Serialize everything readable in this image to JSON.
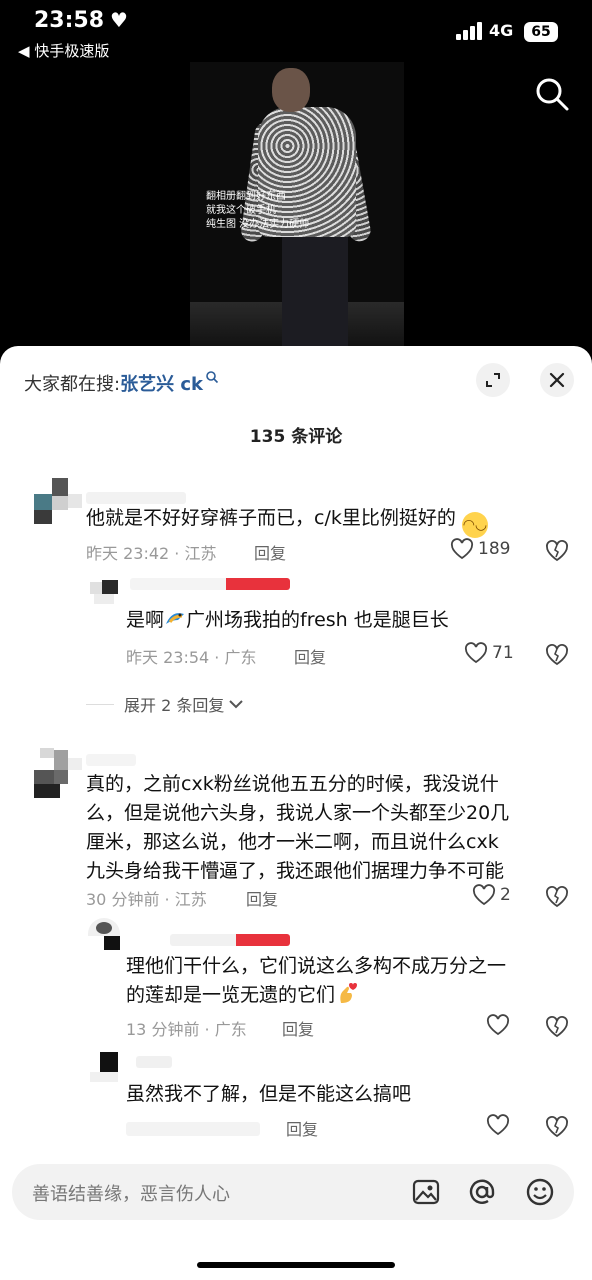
{
  "status": {
    "time": "23:58",
    "back_app": "快手极速版",
    "network": "4G",
    "battery": "65"
  },
  "video": {
    "caption": "翻相册翻到好东西\n就我这个破手机\n纯生图 没办法实力硬帅"
  },
  "sheet": {
    "search_prefix": "大家都在搜:",
    "search_keyword": "张艺兴 ck",
    "comment_count": "135 条评论"
  },
  "comments": [
    {
      "text": "他就是不好好穿裤子而已，c/k里比例挺好的",
      "meta": "昨天 23:42 · 江苏",
      "reply_label": "回复",
      "likes": "189"
    },
    {
      "text": "是啊",
      "text2": "广州场我拍的fresh 也是腿巨长",
      "meta": "昨天 23:54 · 广东",
      "reply_label": "回复",
      "likes": "71"
    },
    {
      "expand_label": "展开 2 条回复"
    },
    {
      "text_lines": [
        "真的，之前cxk粉丝说他五五分的时候，我没说什",
        "么，但是说他六头身，我说人家一个头都至少20几",
        "厘米，那这么说，他才一米二啊，而且说什么cxk",
        "九头身给我干懵逼了，我还跟他们据理力争不可能"
      ],
      "meta": "30 分钟前 · 江苏",
      "reply_label": "回复",
      "likes": "2"
    },
    {
      "text_lines": [
        "理他们干什么，它们说这么多构不成万分之一",
        "的莲却是一览无遗的它们"
      ],
      "meta": "13 分钟前 · 广东",
      "reply_label": "回复"
    },
    {
      "text": "虽然我不了解，但是不能这么搞吧",
      "reply_label": "回复"
    }
  ],
  "input": {
    "placeholder": "善语结善缘，恶言伤人心"
  },
  "colors": {
    "keyword": "#2b5c98",
    "name_blur_red": "#e8323c"
  }
}
